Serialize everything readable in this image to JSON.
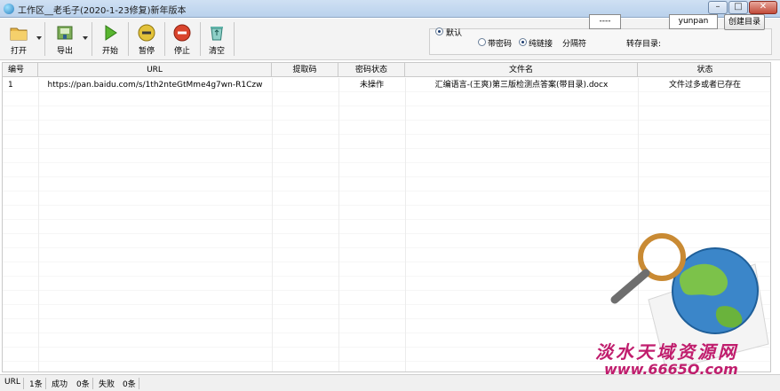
{
  "window": {
    "title": "工作区__老毛子(2020-1-23修复)新年版本",
    "minimize_label": "–",
    "maximize_label": "□",
    "close_label": "✕"
  },
  "toolbar": {
    "open_label": "打开",
    "export_label": "导出",
    "start_label": "开始",
    "pause_label": "暂停",
    "stop_label": "停止",
    "clear_label": "清空"
  },
  "options": {
    "default_label": "默认",
    "with_code_label": "带密码",
    "pure_link_label": "纯链接",
    "separator_label": "分隔符",
    "separator_value": "----",
    "save_dir_label": "转存目录:",
    "save_dir_value": "yunpan",
    "create_dir_label": "创建目录",
    "selected": [
      "default",
      "pure_link"
    ]
  },
  "table": {
    "columns": [
      "编号",
      "URL",
      "提取码",
      "密码状态",
      "文件名",
      "状态"
    ],
    "rows": [
      {
        "id": "1",
        "url": "https://pan.baidu.com/s/1th2nteGtMme4g7wn-R1Czw",
        "code": "",
        "pwd_status": "未操作",
        "filename": "汇编语言-(王爽)第三版检测点答案(带目录).docx",
        "status": "文件过多或者已存在"
      }
    ]
  },
  "statusbar": {
    "url_label": "URL",
    "url_count": "1条",
    "success_label": "成功",
    "success_count": "0条",
    "fail_label": "失败",
    "fail_count": "0条"
  },
  "watermark": {
    "line1": "淡水天域资源网",
    "line2": "www.6665Q.com"
  },
  "colors": {
    "watermark": "#c01d6d",
    "titlebar": "#c5d9ef"
  }
}
